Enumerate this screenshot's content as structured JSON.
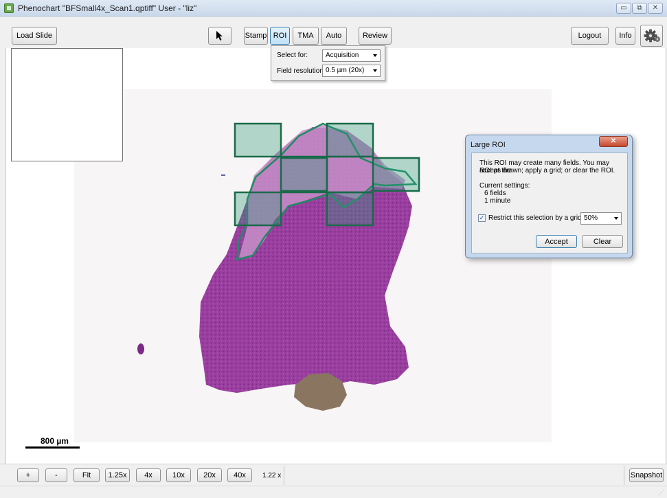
{
  "window": {
    "title": "Phenochart \"BFSmall4x_Scan1.qptiff\"  User - \"liz\"",
    "controls": {
      "minimize": "▭",
      "maximize": "⧉",
      "close": "✕"
    }
  },
  "toolbar": {
    "load_slide": "Load Slide",
    "select_tool_icon": "arrow-pointer-icon",
    "stamp": "Stamp",
    "roi": "ROI",
    "tma": "TMA",
    "auto": "Auto",
    "review": "Review",
    "logout": "Logout",
    "info": "Info",
    "settings_icon": "gear-icon"
  },
  "roi_panel": {
    "select_for_label": "Select for:",
    "select_for_value": "Acquisition",
    "field_resolution_label": "Field resolution:",
    "field_resolution_value": "0.5 µm (20x)"
  },
  "viewer": {
    "scale_bar_label": "800 µm",
    "roi_fields_count": 6,
    "colors": {
      "roi_outline": "#1e8c62",
      "field_fill": "#2e9a78",
      "field_border": "#1a6a4a",
      "tissue": "#9a3fa0",
      "tissue_light": "#c58fc8"
    }
  },
  "dialog": {
    "title": "Large ROI",
    "close": "✕",
    "message_line1": "This ROI may create many fields. You may accept the",
    "message_line2": "ROI as drawn; apply a grid; or clear the ROI.",
    "settings_heading": "Current settings:",
    "fields_value": "6 fields",
    "time_value": "1 minute",
    "restrict_checked": true,
    "restrict_label": "Restrict this selection by a grid of",
    "grid_value": "50%",
    "accept": "Accept",
    "clear": "Clear"
  },
  "bottom": {
    "zoom_in": "+",
    "zoom_out": "-",
    "fit": "Fit",
    "z125": "1.25x",
    "z4": "4x",
    "z10": "10x",
    "z20": "20x",
    "z40": "40x",
    "zoom_level": "1.22 x",
    "snapshot": "Snapshot"
  }
}
